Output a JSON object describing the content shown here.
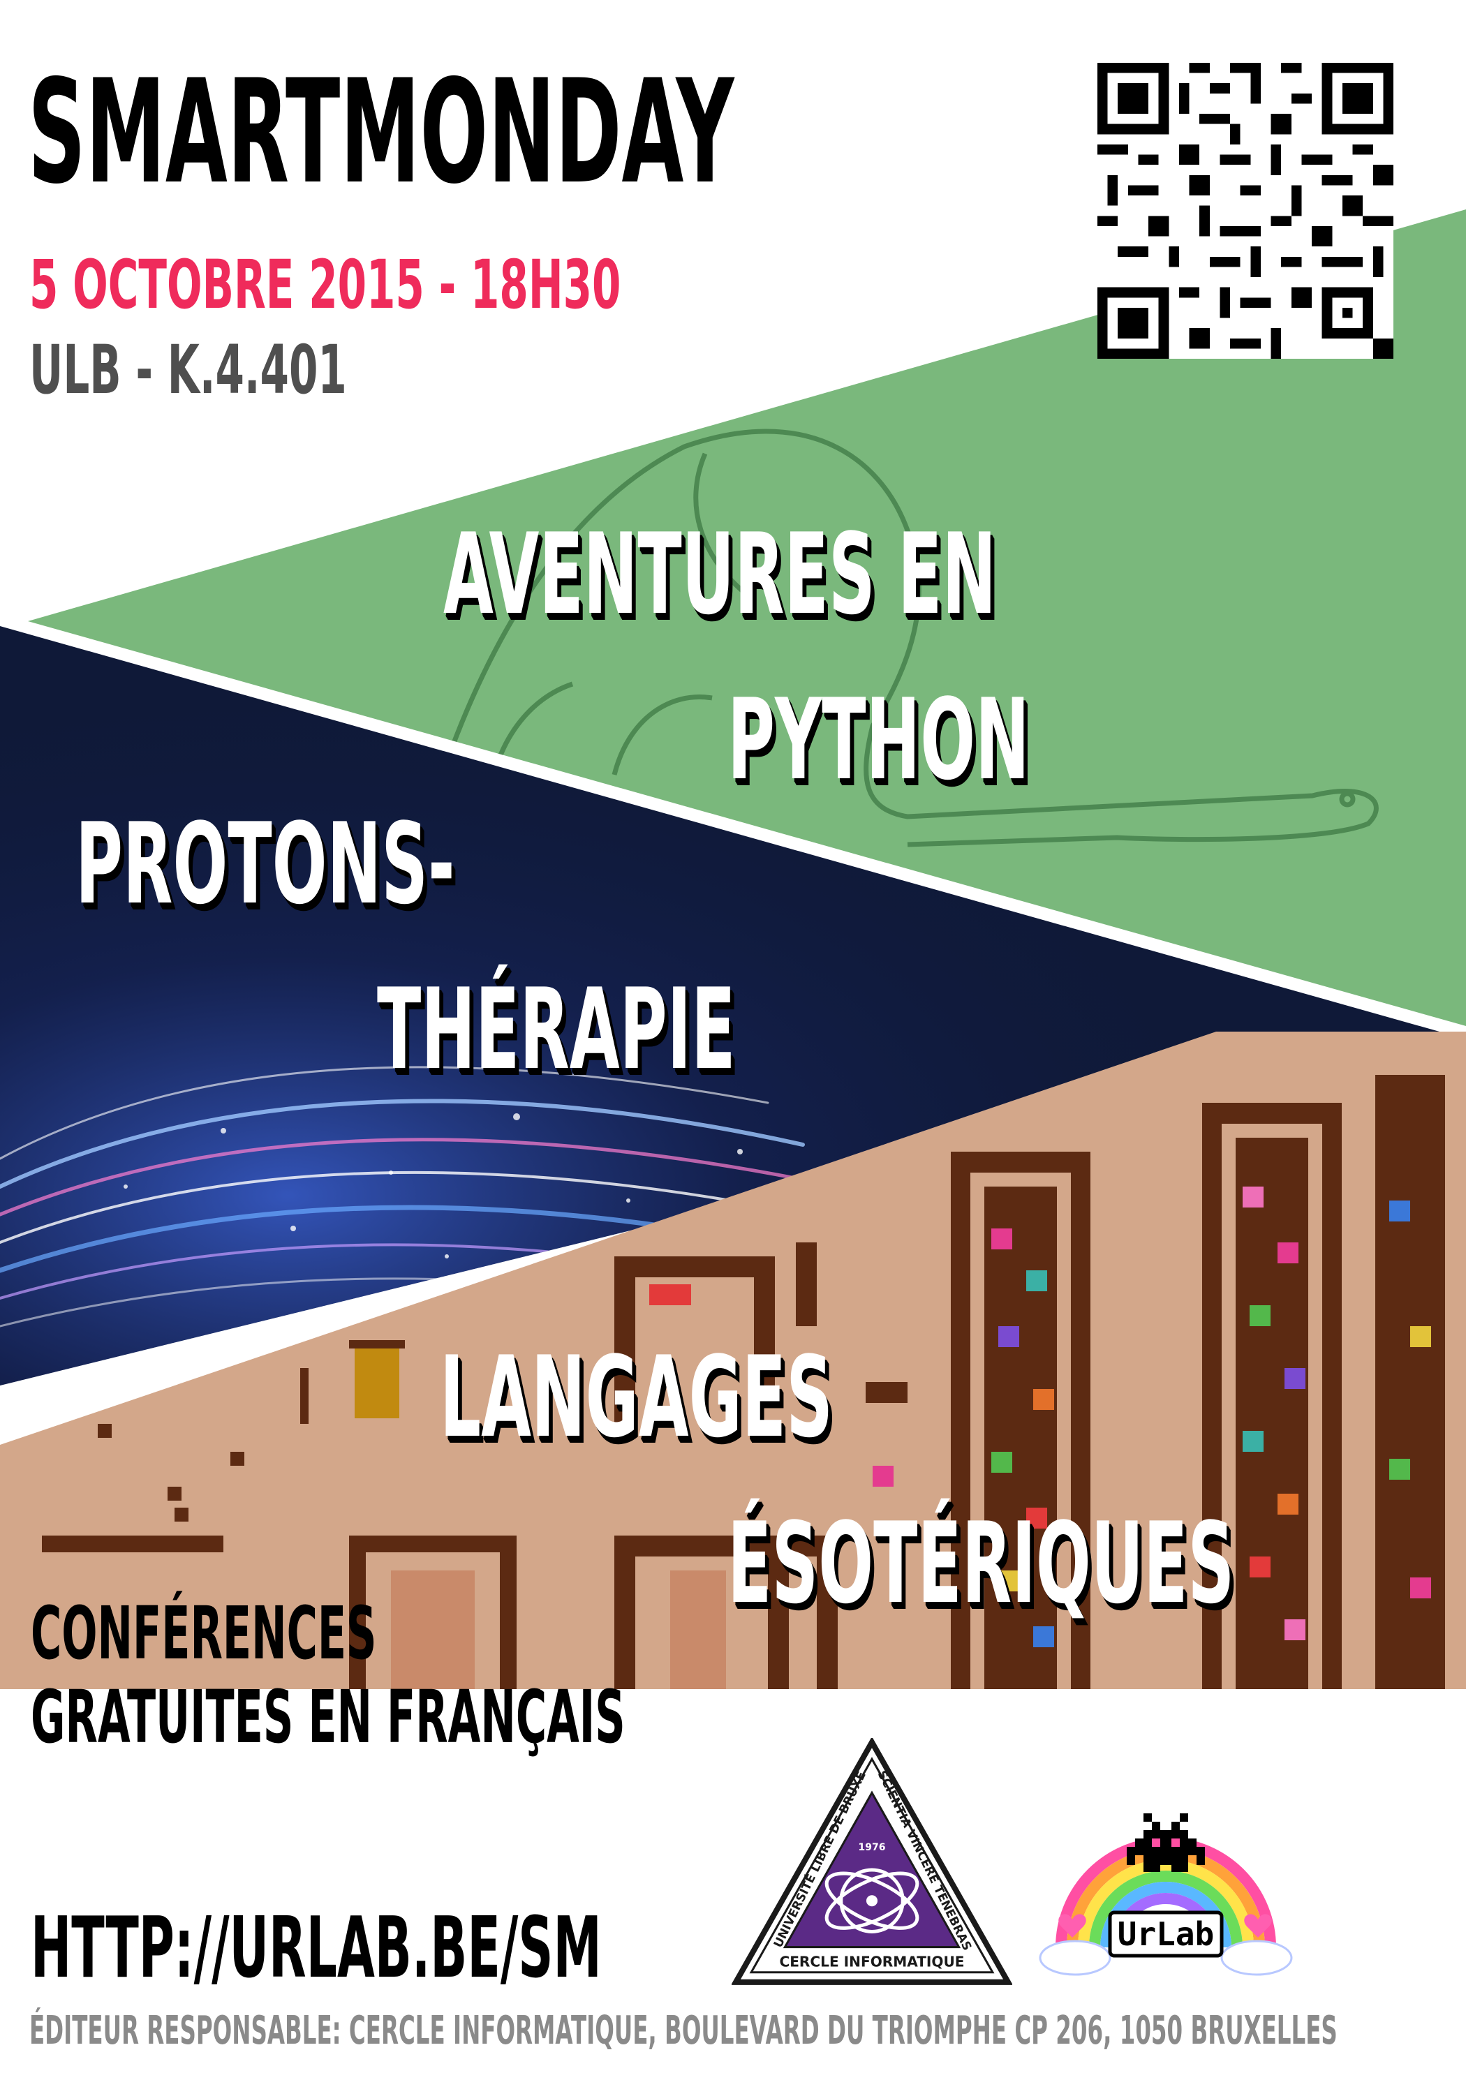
{
  "event": {
    "title": "SMARTMONDAY",
    "datetime": "5 OCTOBRE 2015 - 18H30",
    "location": "ULB - K.4.401"
  },
  "talks": [
    {
      "line1": "AVENTURES EN",
      "line2": "PYTHON",
      "band_color": "#7ab87c"
    },
    {
      "line1": "PROTONS-",
      "line2": "THÉRAPIE",
      "band_color": "#0f1938"
    },
    {
      "line1": "LANGAGES",
      "line2": "ÉSOTÉRIQUES",
      "band_color": "#d3a78a"
    }
  ],
  "footer": {
    "conferences_line1": "CONFÉRENCES",
    "conferences_line2": "GRATUITES EN FRANÇAIS",
    "url": "HTTP://URLAB.BE/SM",
    "editor": "ÉDITEUR RESPONSABLE: CERCLE INFORMATIQUE, BOULEVARD DU TRIOMPHE CP 206, 1050 BRUXELLES"
  },
  "logos": {
    "cercle_informatique": {
      "left_text": "UNIVERSITÉ LIBRE DE BRUXELLES",
      "right_text": "SCIENTIA VINCERE TENEBRAS",
      "bottom_text": "CERCLE INFORMATIQUE",
      "year": "1976",
      "color": "#5b2a86"
    },
    "urlab": {
      "text": "UrLab"
    }
  },
  "colors": {
    "accent": "#ef2b5b",
    "location_gray": "#4f4f4f",
    "green_band": "#7ab87c",
    "navy_band": "#0f1938",
    "tan_band": "#d3a78a",
    "maze_brown": "#5c2a12"
  }
}
